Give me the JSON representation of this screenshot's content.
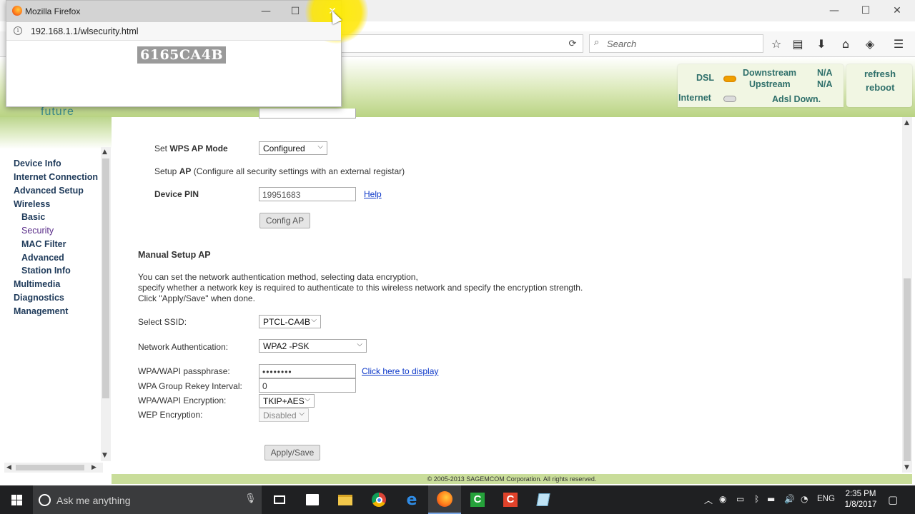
{
  "main_window": {
    "controls": {
      "minimize": "—",
      "maximize": "☐",
      "close": "✕"
    },
    "toolbar": {
      "search_placeholder": "Search",
      "reload_icon": "⟳",
      "icons": [
        "☆",
        "▤",
        "⬇",
        "⌂",
        "◈",
        "☰"
      ]
    }
  },
  "popup": {
    "title": "Mozilla Firefox",
    "url": "192.168.1.1/wlsecurity.html",
    "displayed_text": "6165CA4B",
    "controls": {
      "minimize": "—",
      "maximize": "☐",
      "close": "✕"
    }
  },
  "header": {
    "brand_text": "future",
    "status": {
      "dsl_label": "DSL",
      "internet_label": "Internet",
      "downstream_label": "Downstream",
      "upstream_label": "Upstream",
      "downstream_value": "N/A",
      "upstream_value": "N/A",
      "adsl_status": "Adsl Down.",
      "dsl_led_color": "#f0a000",
      "internet_led_color": "#dcdcdc"
    },
    "refresh_label": "refresh",
    "reboot_label": "reboot"
  },
  "sidebar": {
    "items": [
      {
        "label": "Device Info"
      },
      {
        "label": "Internet Connection"
      },
      {
        "label": "Advanced Setup"
      },
      {
        "label": "Wireless"
      },
      {
        "label": "Basic"
      },
      {
        "label": "Security"
      },
      {
        "label": "MAC Filter"
      },
      {
        "label": "Advanced"
      },
      {
        "label": "Station Info"
      },
      {
        "label": "Multimedia"
      },
      {
        "label": "Diagnostics"
      },
      {
        "label": "Management"
      }
    ]
  },
  "wps": {
    "mode_prefix": "Set ",
    "mode_bold": "WPS AP Mode",
    "mode_value": "Configured",
    "setup_prefix": "Setup ",
    "setup_bold": "AP",
    "setup_rest": " (Configure all security settings with an external registar)",
    "pin_label": "Device PIN",
    "pin_value": "19951683",
    "help_link": "Help",
    "config_button": "Config AP"
  },
  "manual": {
    "heading": "Manual Setup AP",
    "desc_line1": "You can set the network authentication method, selecting data encryption,",
    "desc_line2": "specify whether a network key is required to authenticate to this wireless network and specify the encryption strength.",
    "desc_line3": "Click \"Apply/Save\" when done.",
    "ssid_label": "Select SSID:",
    "ssid_value": "PTCL-CA4B",
    "auth_label": "Network Authentication:",
    "auth_value": "WPA2 -PSK",
    "passphrase_label": "WPA/WAPI passphrase:",
    "passphrase_value": "••••••••",
    "display_link": "Click here to display",
    "rekey_label": "WPA Group Rekey Interval:",
    "rekey_value": "0",
    "encryption_label": "WPA/WAPI Encryption:",
    "encryption_value": "TKIP+AES",
    "wep_label": "WEP Encryption:",
    "wep_value": "Disabled",
    "apply_button": "Apply/Save"
  },
  "footer": {
    "copyright": "© 2005-2013 SAGEMCOM Corporation. All rights reserved."
  },
  "taskbar": {
    "search_placeholder": "Ask me anything",
    "language": "ENG",
    "time": "2:35 PM",
    "date": "1/8/2017"
  }
}
